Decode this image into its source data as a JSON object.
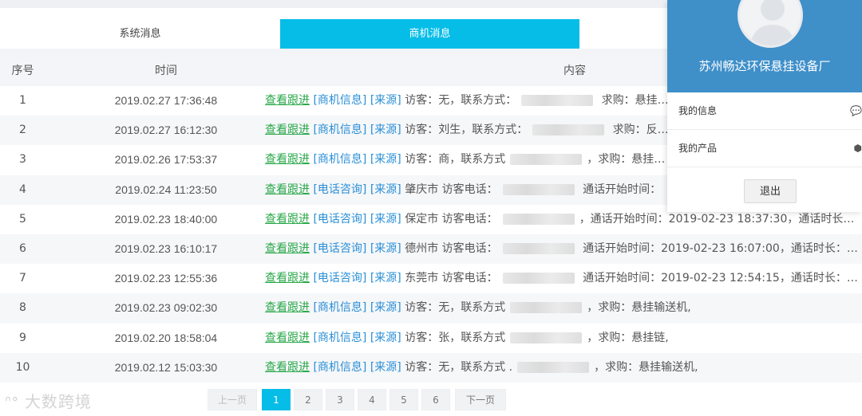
{
  "tabs": [
    {
      "label": "系统消息"
    },
    {
      "label": "商机消息"
    },
    {
      "label": ""
    }
  ],
  "table": {
    "headers": {
      "index": "序号",
      "time": "时间",
      "content": "内容"
    },
    "rows": [
      {
        "index": "1",
        "time": "2019.02.27 17:36:48",
        "follow": "查看跟进",
        "type": "[商机信息]",
        "source": "[来源]",
        "pre": " 访客：无，联系方式：",
        "post": " 求购：悬挂…"
      },
      {
        "index": "2",
        "time": "2019.02.27 16:12:30",
        "follow": "查看跟进",
        "type": "[商机信息]",
        "source": "[来源]",
        "pre": " 访客：刘生，联系方式：",
        "post": " 求购：反…"
      },
      {
        "index": "3",
        "time": "2019.02.26 17:53:37",
        "follow": "查看跟进",
        "type": "[商机信息]",
        "source": "[来源]",
        "pre": " 访客：商，联系方式",
        "post": "，求购：悬挂…"
      },
      {
        "index": "4",
        "time": "2019.02.24 11:23:50",
        "follow": "查看跟进",
        "type": "[电话咨询]",
        "source": "[来源]",
        "pre": " 肇庆市 访客电话：",
        "post": " 通话开始时间："
      },
      {
        "index": "5",
        "time": "2019.02.23 18:40:00",
        "follow": "查看跟进",
        "type": "[电话咨询]",
        "source": "[来源]",
        "pre": " 保定市 访客电话：",
        "post": "，通话开始时间：2019-02-23 18:37:30，通话时长：1…"
      },
      {
        "index": "6",
        "time": "2019.02.23 16:10:17",
        "follow": "查看跟进",
        "type": "[电话咨询]",
        "source": "[来源]",
        "pre": " 德州市 访客电话：",
        "post": " 通话开始时间：2019-02-23 16:07:00，通话时长：1…"
      },
      {
        "index": "7",
        "time": "2019.02.23 12:55:36",
        "follow": "查看跟进",
        "type": "[电话咨询]",
        "source": "[来源]",
        "pre": " 东莞市 访客电话：",
        "post": " 通话开始时间：2019-02-23 12:54:15，通话时长：8…"
      },
      {
        "index": "8",
        "time": "2019.02.23 09:02:30",
        "follow": "查看跟进",
        "type": "[商机信息]",
        "source": "[来源]",
        "pre": " 访客：无，联系方式",
        "post": "，求购：悬挂输送机,"
      },
      {
        "index": "9",
        "time": "2019.02.20 18:58:04",
        "follow": "查看跟进",
        "type": "[商机信息]",
        "source": "[来源]",
        "pre": " 访客：张，联系方式",
        "post": "，求购：悬挂链,"
      },
      {
        "index": "10",
        "time": "2019.02.12 15:03:30",
        "follow": "查看跟进",
        "type": "[商机信息]",
        "source": "[来源]",
        "pre": " 访客：无，联系方式 .",
        "post": "，求购：悬挂输送机,"
      }
    ]
  },
  "pagination": {
    "prev": "上一页",
    "pages": [
      "1",
      "2",
      "3",
      "4",
      "5",
      "6"
    ],
    "active_page": "1",
    "next": "下一页"
  },
  "watermark": "大数跨境",
  "profile_panel": {
    "company": "苏州畅达环保悬挂设备厂",
    "menu": [
      {
        "label": "我的信息",
        "icon": "chat-icon"
      },
      {
        "label": "我的产品",
        "icon": "cube-icon"
      }
    ],
    "logout": "退出"
  },
  "colors": {
    "accent": "#06bde8",
    "panel_header": "#3f8fc9",
    "link_green": "#2aa84a",
    "tag_blue": "#2a8fd6"
  }
}
